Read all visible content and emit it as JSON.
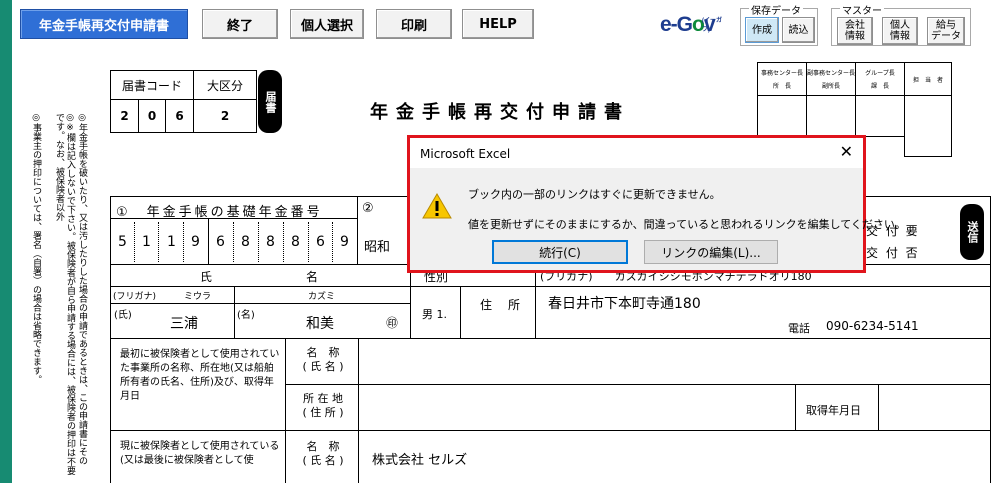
{
  "toolbar": {
    "title_button": "年金手帳再交付申請書",
    "end_button": "終了",
    "select_button": "個人選択",
    "print_button": "印刷",
    "help_button": "HELP",
    "egov_logo_e": "e-G",
    "egov_logo_o": "o",
    "egov_logo_v": "v",
    "egov_logo_sup": "(イーガブ)",
    "save_group": {
      "title": "保存データ",
      "create": "作成",
      "read": "読込"
    },
    "master_group": {
      "title": "マスター",
      "company": "会社\n情報",
      "personal": "個人\n情報",
      "salary": "給与\nデータ"
    }
  },
  "form": {
    "title": "年金手帳再交付申請書",
    "form_code_label": "届書コード",
    "form_code": [
      "2",
      "0",
      "6"
    ],
    "category_label": "大区分",
    "category": "2",
    "todoke": "届書",
    "office_header": {
      "col1_top": "事務センター長",
      "col1_bottom": "所　長",
      "col2_top": "副事務センター長",
      "col2_bottom": "副所長",
      "col3_top": "グループ長",
      "col3_bottom": "課　長",
      "col4": "担　当　者"
    },
    "notes_right": "◎年金手帳を破いたり、又は汚したりした場合の申請であるときは、この申請書にその",
    "notes_middle": "◎※欄は記入しないで下さい。被保険者が自ら申請する場合には、被保険者の押印は不要です。なお、被保険者以外",
    "notes_left": "◎事業主の押印については、署名（自署）の場合は省略できます。",
    "pension_number_label": "①　年金手帳の基礎年金番号",
    "circle2": "②",
    "pension_number": [
      "5",
      "1",
      "1",
      "9",
      "6",
      "8",
      "8",
      "8",
      "6",
      "9"
    ],
    "showa": "昭和",
    "issue_required": "交 付 要",
    "issue_not": "交 付 否",
    "send": "送信",
    "name_header_left": "氏",
    "name_header_right": "名",
    "gender_header": "性別",
    "furigana_label": "(フリガナ)",
    "furigana_sei": "ミウラ",
    "furigana_mei": "カズミ",
    "furigana_addr": "(フリガナ)　　カスガイシシモホンマチテラドオリ180",
    "sei_label": "(氏)",
    "sei": "三浦",
    "mei_label": "(名)",
    "mei": "和美",
    "seal": "㊞",
    "gender": "男 1.",
    "address_label": "住　所",
    "address": "春日井市下本町寺通180",
    "phone_label": "電話",
    "phone": "090-6234-5141",
    "first_employer_label": "最初に被保険者として使用されていた事業所の名称、所在地(又は船舶所有者の氏名、住所)及び、取得年月日",
    "name_label": "名　称\n( 氏 名 )",
    "location_label": "所 在 地\n( 住 所 )",
    "acquired_label": "取得年月日",
    "current_employer_label": "現に被保険者として使用されている(又は最後に被保険者として使",
    "current_name_label": "名　称\n( 氏 名 )",
    "current_company": "株式会社 セルズ"
  },
  "dialog": {
    "title": "Microsoft Excel",
    "close": "✕",
    "message1": "ブック内の一部のリンクはすぐに更新できません。",
    "message2": "値を更新せずにそのままにするか、間違っていると思われるリンクを編集してください。",
    "continue_button": "続行(C)",
    "edit_links_button": "リンクの編集(L)..."
  },
  "colors": {
    "accent": "#2f6fd6",
    "left_strip": "#178b72",
    "dialog_outline": "#e0141c",
    "warning": "#f7c600"
  }
}
